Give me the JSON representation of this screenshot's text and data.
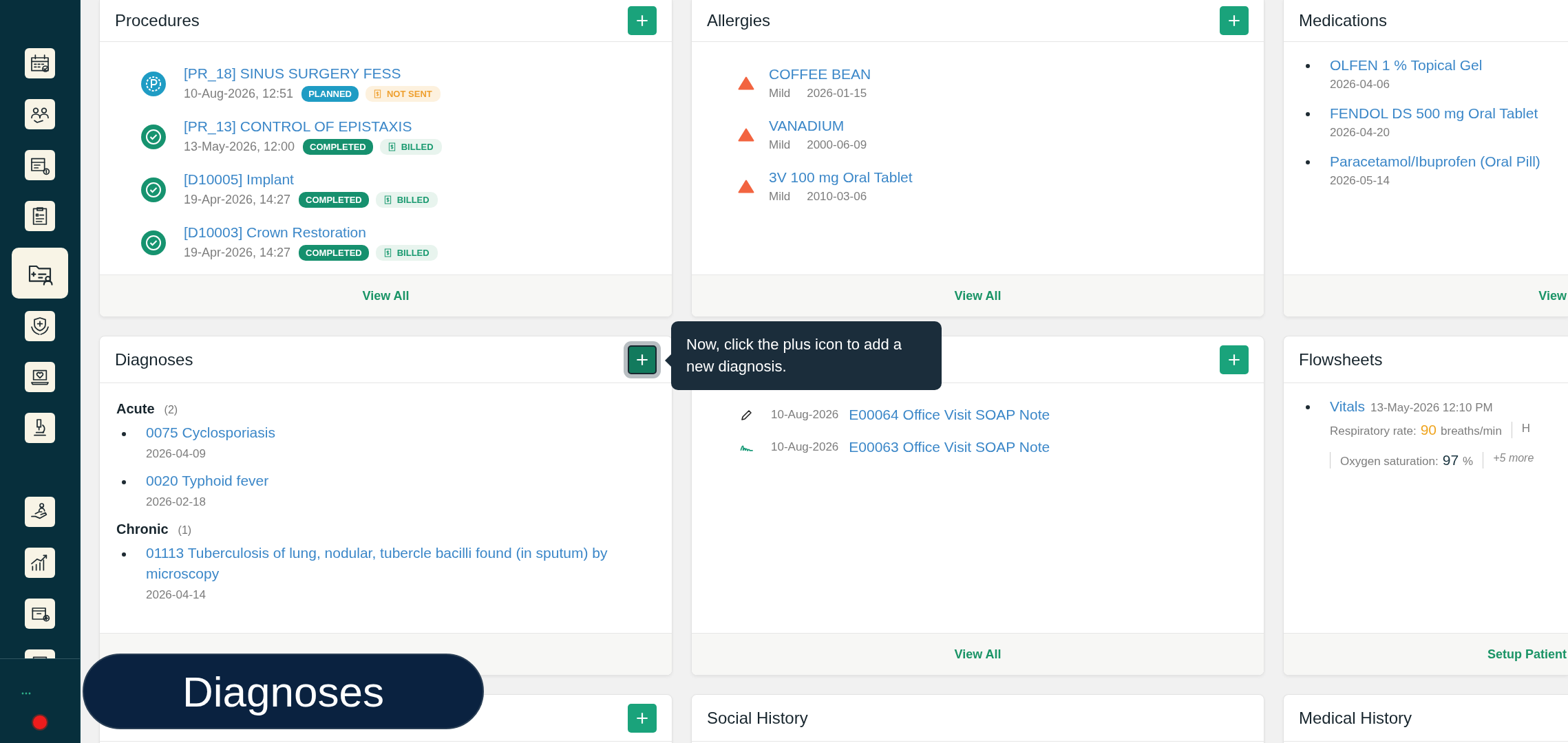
{
  "sidebar": {
    "sections": [
      {
        "items": [
          {
            "selected": false
          },
          {
            "selected": false
          },
          {
            "selected": false
          },
          {
            "selected": false
          },
          {
            "selected": true
          },
          {
            "selected": false
          },
          {
            "selected": false
          },
          {
            "selected": false
          }
        ]
      },
      {
        "items": [
          {
            "selected": false
          },
          {
            "selected": false
          },
          {
            "selected": false
          },
          {
            "selected": false
          }
        ]
      }
    ]
  },
  "rows": [
    {
      "cards": [
        {
          "kind": "procedures",
          "title": "Procedures",
          "add_button": true,
          "footer": "View All",
          "items": [
            {
              "title": "[PR_18] SINUS SURGERY FESS",
              "datetime": "10-Aug-2026, 12:51",
              "status": {
                "label": "PLANNED",
                "kind": "planned"
              },
              "billing": {
                "label": "NOT SENT",
                "kind": "not_sent"
              }
            },
            {
              "title": "[PR_13] CONTROL OF EPISTAXIS",
              "datetime": "13-May-2026, 12:00",
              "status": {
                "label": "COMPLETED",
                "kind": "completed"
              },
              "billing": {
                "label": "BILLED",
                "kind": "billed"
              }
            },
            {
              "title": "[D10005] Implant",
              "datetime": "19-Apr-2026, 14:27",
              "status": {
                "label": "COMPLETED",
                "kind": "completed"
              },
              "billing": {
                "label": "BILLED",
                "kind": "billed"
              }
            },
            {
              "title": "[D10003] Crown Restoration",
              "datetime": "19-Apr-2026, 14:27",
              "status": {
                "label": "COMPLETED",
                "kind": "completed"
              },
              "billing": {
                "label": "BILLED",
                "kind": "billed"
              }
            }
          ]
        },
        {
          "kind": "allergies",
          "title": "Allergies",
          "add_button": true,
          "footer": "View All",
          "items": [
            {
              "name": "COFFEE BEAN",
              "severity": "Mild",
              "date": "2026-01-15"
            },
            {
              "name": "VANADIUM",
              "severity": "Mild",
              "date": "2000-06-09"
            },
            {
              "name": "3V 100 mg Oral Tablet",
              "severity": "Mild",
              "date": "2010-03-06"
            }
          ]
        },
        {
          "kind": "medications",
          "title": "Medications",
          "footer": "View",
          "items": [
            {
              "name": "OLFEN 1 % Topical Gel",
              "date": "2026-04-06"
            },
            {
              "name": "FENDOL DS 500 mg Oral Tablet",
              "date": "2026-04-20"
            },
            {
              "name": "Paracetamol/Ibuprofen (Oral Pill)",
              "date": "2026-05-14"
            }
          ]
        }
      ]
    },
    {
      "cards": [
        {
          "kind": "diagnoses",
          "title": "Diagnoses",
          "add_button": true,
          "highlighted": true,
          "groups": [
            {
              "name": "Acute",
              "count": "(2)",
              "items": [
                {
                  "name": "0075 Cyclosporiasis",
                  "date": "2026-04-09"
                },
                {
                  "name": "0020 Typhoid fever",
                  "date": "2026-02-18"
                }
              ]
            },
            {
              "name": "Chronic",
              "count": "(1)",
              "items": [
                {
                  "name": "01113 Tuberculosis of lung, nodular, tubercle bacilli found (in sputum) by microscopy",
                  "date": "2026-04-14"
                }
              ]
            }
          ]
        },
        {
          "kind": "notes",
          "add_button": true,
          "footer": "View All",
          "items": [
            {
              "kind": "draft",
              "date": "10-Aug-2026",
              "title": "E00064 Office Visit SOAP Note"
            },
            {
              "kind": "signed",
              "date": "10-Aug-2026",
              "title": "E00063 Office Visit SOAP Note"
            }
          ]
        },
        {
          "kind": "flowsheets",
          "title": "Flowsheets",
          "footer": "Setup Patient",
          "items": [
            {
              "name": "Vitals",
              "datetime": "13-May-2026 12:10 PM",
              "readings": [
                {
                  "label": "Respiratory rate:",
                  "value": "90",
                  "unit": "breaths/min",
                  "abnormal": true
                },
                {
                  "label": "H"
                },
                {
                  "label": "Oxygen saturation:",
                  "value": "97",
                  "unit": "%",
                  "abnormal": false
                }
              ],
              "more": "+5 more"
            }
          ]
        }
      ]
    },
    {
      "cards": [
        {
          "kind": "empty",
          "add_button": true
        },
        {
          "kind": "empty",
          "title": "Social History"
        },
        {
          "kind": "empty",
          "title": "Medical History"
        }
      ]
    }
  ],
  "tooltip": {
    "text": "Now, click the plus icon to add a new diagnosis."
  },
  "caption": {
    "text": "Diagnoses"
  }
}
